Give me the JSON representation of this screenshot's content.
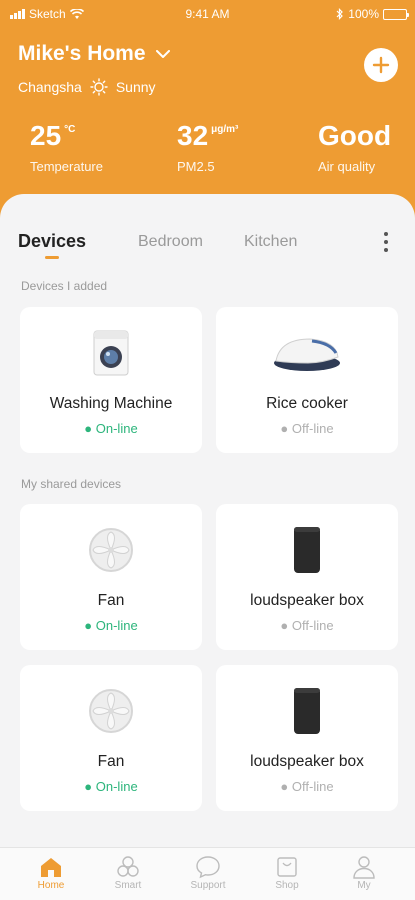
{
  "status_bar": {
    "carrier": "Sketch",
    "time": "9:41 AM",
    "battery": "100%"
  },
  "header": {
    "home_name": "Mike's Home",
    "city": "Changsha",
    "weather": "Sunny",
    "stats": [
      {
        "value": "25",
        "unit": "°C",
        "label": "Temperature"
      },
      {
        "value": "32",
        "unit": "μg/m³",
        "label": "PM2.5"
      },
      {
        "value": "Good",
        "unit": "",
        "label": "Air quality"
      }
    ]
  },
  "tabs": [
    "Devices",
    "Bedroom",
    "Kitchen"
  ],
  "sections": {
    "added": "Devices I added",
    "shared": "My shared devices"
  },
  "devices_added": [
    {
      "name": "Washing Machine",
      "status": "On-line",
      "online": true,
      "icon": "washing-machine-icon"
    },
    {
      "name": "Rice cooker",
      "status": "Off-line",
      "online": false,
      "icon": "rice-cooker-icon"
    }
  ],
  "devices_shared": [
    {
      "name": "Fan",
      "status": "On-line",
      "online": true,
      "icon": "fan-icon"
    },
    {
      "name": "loudspeaker box",
      "status": "Off-line",
      "online": false,
      "icon": "speaker-icon"
    },
    {
      "name": "Fan",
      "status": "On-line",
      "online": true,
      "icon": "fan-icon"
    },
    {
      "name": "loudspeaker box",
      "status": "Off-line",
      "online": false,
      "icon": "speaker-icon"
    }
  ],
  "bottom_nav": [
    {
      "label": "Home",
      "icon": "home-icon",
      "active": true
    },
    {
      "label": "Smart",
      "icon": "smart-icon",
      "active": false
    },
    {
      "label": "Support",
      "icon": "support-icon",
      "active": false
    },
    {
      "label": "Shop",
      "icon": "shop-icon",
      "active": false
    },
    {
      "label": "My",
      "icon": "user-icon",
      "active": false
    }
  ],
  "colors": {
    "accent": "#ee9c33",
    "online": "#2db57c",
    "offline": "#b0b0b0",
    "background": "#f4f4f5"
  }
}
